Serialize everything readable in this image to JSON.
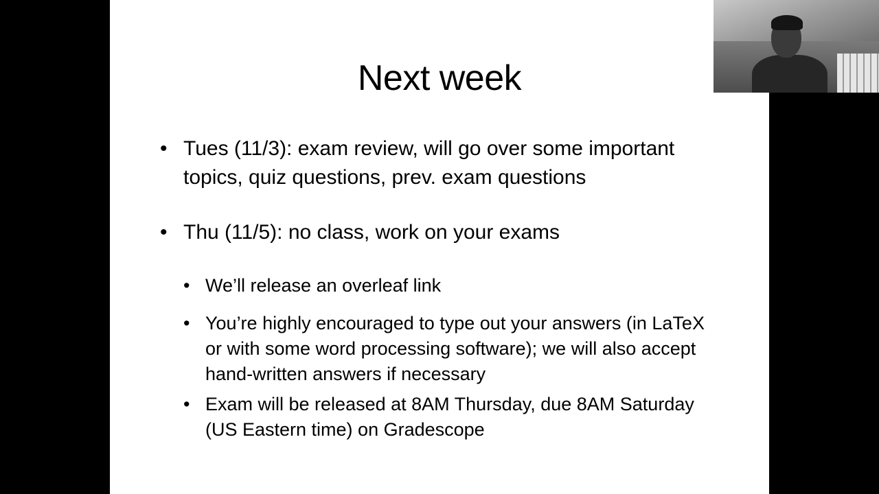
{
  "slide": {
    "title": "Next week",
    "bullets": [
      {
        "marker": "•",
        "text": "Tues (11/3): exam review, will go over some important topics, quiz questions, prev. exam questions"
      },
      {
        "marker": "•",
        "text": "Thu (11/5): no class, work on your exams"
      }
    ],
    "subbullets": [
      {
        "marker": "•",
        "text": "We’ll release an overleaf link"
      },
      {
        "marker": "•",
        "text": "You’re highly encouraged to type out your answers (in LaTeX or with some word processing software); we will also accept hand-written answers if necessary"
      },
      {
        "marker": "•",
        "text": "Exam will be released at 8AM Thursday, due 8AM Saturday (US Eastern time) on Gradescope"
      }
    ]
  },
  "webcam": {
    "description_icon": "presenter-video"
  },
  "colors": {
    "background": "#000000",
    "slide": "#ffffff",
    "text": "#000000"
  }
}
